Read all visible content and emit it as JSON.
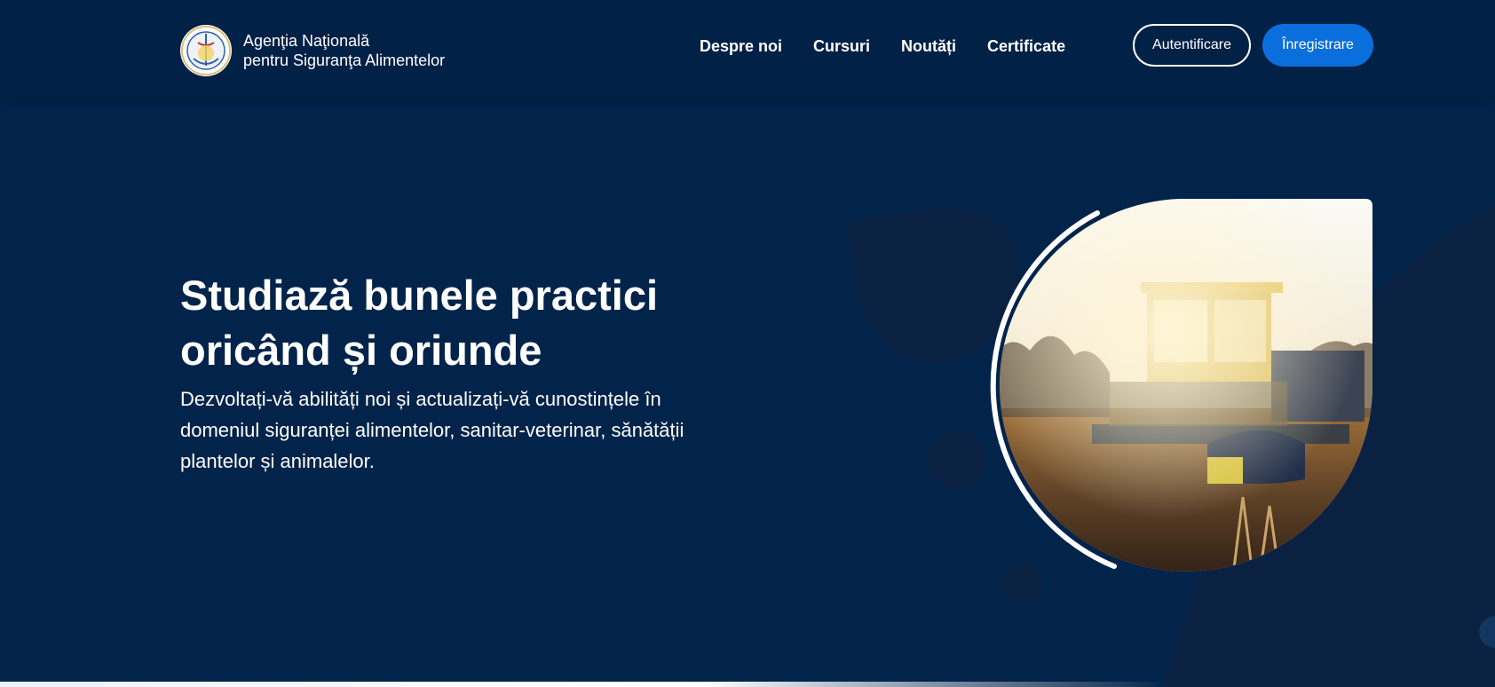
{
  "brand": {
    "logo_icon": "ansvsa-emblem-icon",
    "line1": "Agenţia Naţională",
    "line2": "pentru Siguranţa Alimentelor"
  },
  "nav": {
    "items": [
      {
        "label": "Despre noi"
      },
      {
        "label": "Cursuri"
      },
      {
        "label": "Noutăți"
      },
      {
        "label": "Certificate"
      }
    ]
  },
  "auth": {
    "login_label": "Autentificare",
    "register_label": "Înregistrare"
  },
  "hero": {
    "title_line1": "Studiază bunele practici",
    "title_line2": "oricând și oriunde",
    "subtitle_line1": "Dezvoltați-vă abilități noi și actualizați-vă cunostințele în",
    "subtitle_line2": "domeniul siguranței alimentelor, sanitar-veterinar, sănătății",
    "subtitle_line3": "plantelor și animalelor.",
    "image_icon": "harvester-field-photo"
  },
  "colors": {
    "background": "#02244a",
    "header": "#012146",
    "accent": "#0a6fdc",
    "text": "#ffffff"
  }
}
